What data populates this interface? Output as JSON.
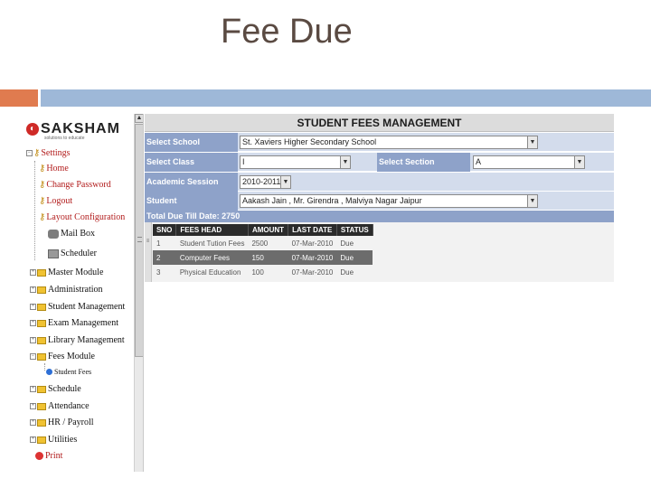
{
  "slide": {
    "title": "Fee Due"
  },
  "app": {
    "brand": "SAKSHAM",
    "tagline": "solutions to educate",
    "panel_title": "STUDENT FEES MANAGEMENT"
  },
  "sidebar": {
    "settings": "Settings",
    "settings_items": [
      "Home",
      "Change Password",
      "Logout",
      "Layout Configuration",
      "Mail Box",
      "Scheduler"
    ],
    "modules": [
      "Master Module",
      "Administration",
      "Student Management",
      "Exam Management",
      "Library Management",
      "Fees Module"
    ],
    "fees_sub": "Student Fees",
    "modules2": [
      "Schedule",
      "Attendance",
      "HR / Payroll",
      "Utilities"
    ],
    "print": "Print"
  },
  "form": {
    "school_label": "Select School",
    "school_value": "St. Xaviers Higher Secondary School",
    "class_label": "Select Class",
    "class_value": "I",
    "section_label": "Select Section",
    "section_value": "A",
    "session_label": "Academic Session",
    "session_value": "2010-2011",
    "student_label": "Student",
    "student_value": "Aakash Jain , Mr. Girendra , Malviya Nagar Jaipur",
    "total_due": "Total Due Till Date: 2750"
  },
  "table": {
    "headers": [
      "SNO",
      "FEES HEAD",
      "AMOUNT",
      "LAST DATE",
      "STATUS"
    ],
    "rows": [
      [
        "1",
        "Student Tution Fees",
        "2500",
        "07-Mar-2010",
        "Due"
      ],
      [
        "2",
        "Computer Fees",
        "150",
        "07-Mar-2010",
        "Due"
      ],
      [
        "3",
        "Physical Education",
        "100",
        "07-Mar-2010",
        "Due"
      ]
    ]
  }
}
